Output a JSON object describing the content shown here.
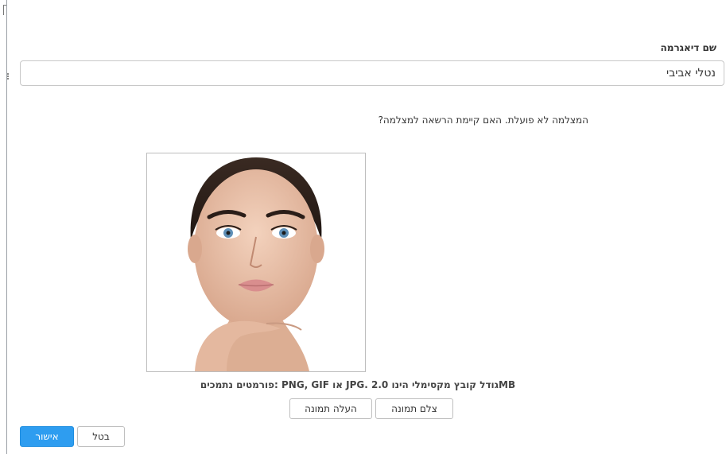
{
  "form": {
    "name_label": "שם דיאגרמה",
    "name_value": "נטלי אביבי"
  },
  "camera": {
    "message": "המצלמה לא פועלת. האם קיימת הרשאה למצלמה?"
  },
  "photo": {
    "formats_text": "פורמטים נתמכים: PNG, GIF או JPG. גודל קובץ מקסימלי הינו 2.0MB"
  },
  "buttons": {
    "capture": "צלם תמונה",
    "upload": "העלה תמונה",
    "cancel": "בטל",
    "ok": "אישור"
  },
  "colors": {
    "primary": "#2e9df0",
    "border": "#c8c8c8"
  }
}
